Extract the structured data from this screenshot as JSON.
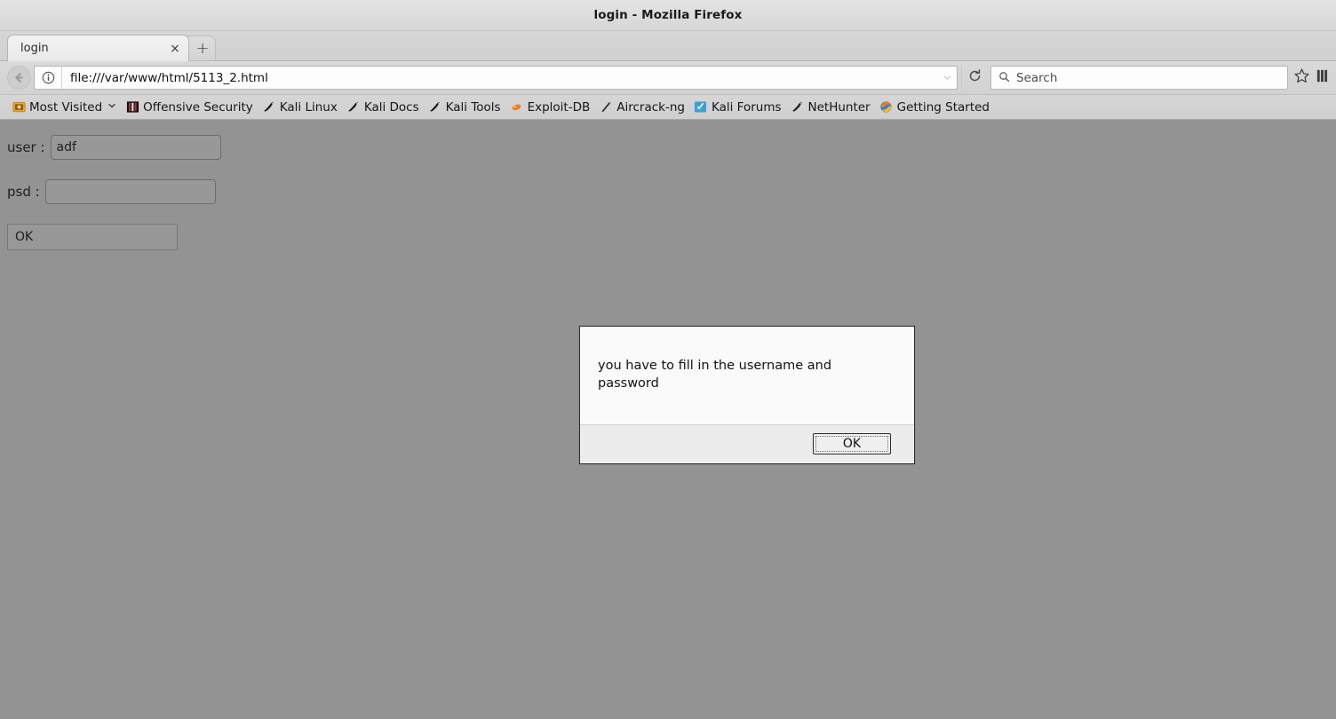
{
  "window": {
    "title": "login - Mozilla Firefox"
  },
  "tabbar": {
    "tabs": [
      {
        "label": "login",
        "close_glyph": "×"
      }
    ],
    "newtab_glyph": "+"
  },
  "navbar": {
    "back_icon": "back-arrow-icon",
    "identity_icon": "page-info-icon",
    "url": "file:///var/www/html/5113_2.html",
    "url_dropdown_icon": "chevron-down-icon",
    "reload_icon": "reload-icon",
    "search": {
      "placeholder": "Search",
      "icon": "search-icon"
    },
    "bookmark_star_icon": "star-icon",
    "library_icon": "library-icon"
  },
  "bookmarks": [
    {
      "label": "Most Visited",
      "icon": "most-visited-icon",
      "has_chevron": true,
      "chevron_glyph": "❯"
    },
    {
      "label": "Offensive Security",
      "icon": "offensive-security-icon",
      "has_chevron": false
    },
    {
      "label": "Kali Linux",
      "icon": "kali-dragon-icon",
      "has_chevron": false
    },
    {
      "label": "Kali Docs",
      "icon": "kali-dragon-icon",
      "has_chevron": false
    },
    {
      "label": "Kali Tools",
      "icon": "kali-dragon-icon",
      "has_chevron": false
    },
    {
      "label": "Exploit-DB",
      "icon": "exploit-db-icon",
      "has_chevron": false
    },
    {
      "label": "Aircrack-ng",
      "icon": "aircrack-ng-icon",
      "has_chevron": false
    },
    {
      "label": "Kali Forums",
      "icon": "kali-forums-icon",
      "has_chevron": false
    },
    {
      "label": "NetHunter",
      "icon": "kali-dragon-icon",
      "has_chevron": false
    },
    {
      "label": "Getting Started",
      "icon": "firefox-icon",
      "has_chevron": false
    }
  ],
  "page": {
    "user_label": "user :",
    "user_value": "adf",
    "psd_label": "psd :",
    "psd_value": "",
    "submit_label": "OK",
    "background_color": "#939393"
  },
  "dialog": {
    "message": "you have to fill in the username and password",
    "ok_label": "OK"
  }
}
